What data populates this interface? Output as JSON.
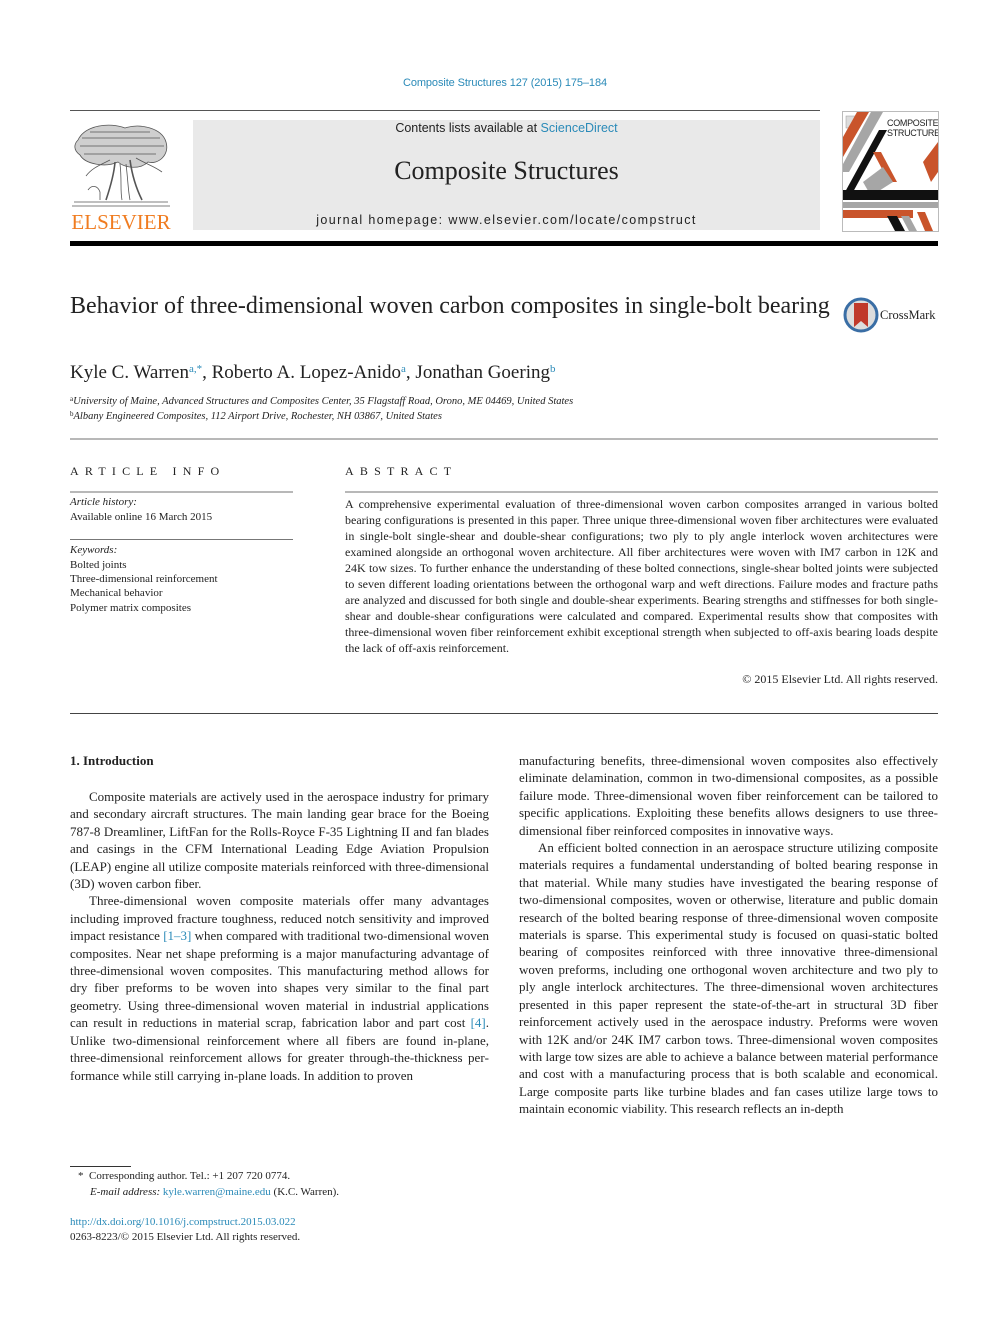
{
  "header": {
    "journal_ref": "Composite Structures 127 (2015) 175–184",
    "contents_prefix": "Contents lists available at ",
    "contents_link": "ScienceDirect",
    "journal_title": "Composite Structures",
    "homepage_prefix": "journal homepage: ",
    "homepage_url": "www.elsevier.com/locate/compstruct",
    "publisher_logo_text": "ELSEVIER",
    "cover_title_line1": "COMPOSITE",
    "cover_title_line2": "STRUCTURES",
    "crossmark_label": "CrossMark"
  },
  "colors": {
    "link": "#2a8ab8",
    "elsevier_orange": "#f07c20",
    "cover_orange": "#c9542b",
    "cover_gray": "#a6a6a6",
    "banner_bg": "#e9e9e9"
  },
  "article": {
    "title": "Behavior of three-dimensional woven carbon composites in single-bolt bearing",
    "authors": [
      {
        "name": "Kyle C. Warren",
        "marks": "a,*"
      },
      {
        "name": "Roberto A. Lopez-Anido",
        "marks": "a"
      },
      {
        "name": "Jonathan Goering",
        "marks": "b"
      }
    ],
    "affiliations": [
      {
        "mark": "a",
        "text": "University of Maine, Advanced Structures and Composites Center, 35 Flagstaff Road, Orono, ME 04469, United States"
      },
      {
        "mark": "b",
        "text": "Albany Engineered Composites, 112 Airport Drive, Rochester, NH 03867, United States"
      }
    ]
  },
  "article_info": {
    "heading": "ARTICLE INFO",
    "history_label": "Article history:",
    "history_value": "Available online 16 March 2015",
    "keywords_label": "Keywords:",
    "keywords": [
      "Bolted joints",
      "Three-dimensional reinforcement",
      "Mechanical behavior",
      "Polymer matrix composites"
    ]
  },
  "abstract": {
    "heading": "ABSTRACT",
    "text": "A comprehensive experimental evaluation of three-dimensional woven carbon composites arranged in various bolted bearing configurations is presented in this paper. Three unique three-dimensional woven fiber architectures were evaluated in single-bolt single-shear and double-shear configurations; two ply to ply angle interlock woven architectures were examined alongside an orthogonal woven architecture. All fiber architectures were woven with IM7 carbon in 12K and 24K tow sizes. To further enhance the under­standing of these bolted connections, single-shear bolted joints were subjected to seven different loading orientations between the orthogonal warp and weft directions. Failure modes and fracture paths are ana­lyzed and discussed for both single and double-shear experiments. Bearing strengths and stiffnesses for both single-shear and double-shear configurations were calculated and compared. Experimental results show that composites with three-dimensional woven fiber reinforcement exhibit exceptional strength when subjected to off-axis bearing loads despite the lack of off-axis reinforcement.",
    "copyright": "© 2015 Elsevier Ltd. All rights reserved."
  },
  "body": {
    "section_heading": "1. Introduction",
    "left_paragraphs": [
      {
        "segments": [
          {
            "text": "Composite materials are actively used in the aerospace industry for primary and secondary aircraft structures. The main landing gear brace for the Boeing 787-8 Dreamliner, LiftFan for the Rolls-Royce F-35 Lightning II and fan blades and casings in the CFM International Leading Edge Aviation Propulsion (LEAP) engine all utilize composite materials reinforced with three-dimensional (3D) woven carbon fiber."
          }
        ]
      },
      {
        "segments": [
          {
            "text": "Three-dimensional woven composite materials offer many advantages including improved fracture toughness, reduced notch sensitivity and improved impact resistance "
          },
          {
            "text": "[1–3]",
            "ref": true
          },
          {
            "text": " when compared with traditional two-dimensional woven composites. Near net shape preforming is a major manufacturing advantage of three-di­mensional woven composites. This manufacturing method allows for dry fiber preforms to be woven into shapes very similar to the final part geometry. Using three-dimensional woven material in industrial applications can result in reductions in material scrap, fabrication labor and part cost "
          },
          {
            "text": "[4]",
            "ref": true
          },
          {
            "text": ". Unlike two-dimensional reinforcement where all fibers are found in-plane, three-dimen­sional reinforcement allows for greater through-the-thickness per­formance while still carrying in-plane loads. In addition to proven"
          }
        ]
      }
    ],
    "right_paragraphs": [
      {
        "continued": true,
        "segments": [
          {
            "text": "manufacturing benefits, three-dimensional woven composites also effectively eliminate delamination, common in two-dimensional composites, as a possible failure mode. Three-dimensional woven fiber reinforcement can be tailored to specific applications. Exploiting these benefits allows designers to use three-dimen­sional fiber reinforced composites in innovative ways."
          }
        ]
      },
      {
        "continued": false,
        "segments": [
          {
            "text": "An efficient bolted connection in an aerospace structure utiliz­ing composite materials requires a fundamental understanding of bolted bearing response in that material. While many studies have investigated the bearing response of two-dimensional composites, woven or otherwise, literature and public domain research of the bolted bearing response of three-dimensional woven composite materials is sparse. This experimental study is focused on quasi-static bolted bearing of composites reinforced with three innova­tive three-dimensional woven preforms, including one orthogonal woven architecture and two ply to ply angle interlock architec­tures. The three-dimensional woven architectures presented in this paper represent the state-of-the-art in structural 3D fiber reinforcement actively used in the aerospace industry. Preforms were woven with 12K and/or 24K IM7 carbon tows. Three-dimen­sional woven composites with large tow sizes are able to achieve a balance between material performance and cost with a manufac­turing process that is both scalable and economical. Large compos­ite parts like turbine blades and fan cases utilize large tows to maintain economic viability. This research reflects an in-depth"
          }
        ]
      }
    ]
  },
  "footnotes": {
    "corresponding_mark": "*",
    "corresponding_text": "Corresponding author. Tel.: +1 207 720 0774.",
    "email_label": "E-mail address:",
    "email": "kyle.warren@maine.edu",
    "email_suffix": " (K.C. Warren).",
    "doi": "http://dx.doi.org/10.1016/j.compstruct.2015.03.022",
    "issn_line": "0263-8223/© 2015 Elsevier Ltd. All rights reserved."
  }
}
